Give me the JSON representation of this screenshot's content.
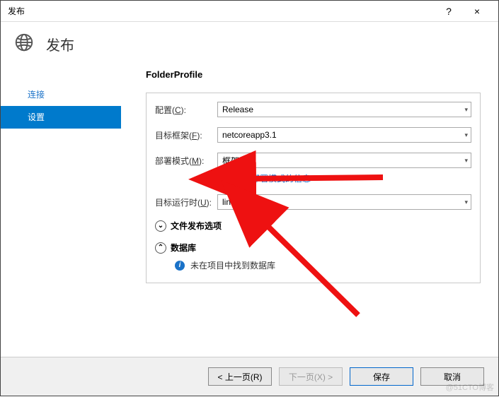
{
  "titlebar": {
    "title": "发布",
    "help": "?",
    "close": "×"
  },
  "header": {
    "title": "发布"
  },
  "sidebar": {
    "items": [
      {
        "label": "连接",
        "active": false
      },
      {
        "label": "设置",
        "active": true
      }
    ]
  },
  "main": {
    "profile_name": "FolderProfile",
    "rows": {
      "config": {
        "label_pre": "配置(",
        "label_u": "C",
        "label_post": "):",
        "value": "Release"
      },
      "framework": {
        "label_pre": "目标框架(",
        "label_u": "F",
        "label_post": "):",
        "value": "netcoreapp3.1"
      },
      "deploy": {
        "label_pre": "部署模式(",
        "label_u": "M",
        "label_post": "):",
        "value": "框架依赖"
      },
      "runtime": {
        "label_pre": "目标运行时(",
        "label_u": "U",
        "label_post": "):",
        "value": "linux-x64"
      }
    },
    "deploy_link": "了解有关部署模式的信息",
    "sections": {
      "file_opts": {
        "chev": "⌄",
        "label": "文件发布选项"
      },
      "database": {
        "chev": "⌃",
        "label": "数据库",
        "msg": "未在项目中找到数据库"
      }
    }
  },
  "footer": {
    "prev": "< 上一页(R)",
    "next": "下一页(X) >",
    "save": "保存",
    "cancel": "取消"
  },
  "watermark": "@51CTO博客"
}
